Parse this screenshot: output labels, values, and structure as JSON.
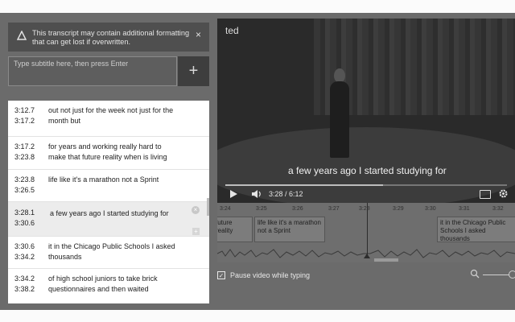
{
  "warning": {
    "text": "This transcript may contain additional formatting that can get lost if overwritten.",
    "dismiss_icon": "close-icon",
    "icon": "warning-triangle-icon"
  },
  "subtitle_input": {
    "placeholder": "Type subtitle here, then press Enter",
    "add_icon": "plus-icon"
  },
  "captions": [
    {
      "start": "3:12.7",
      "end": "3:17.2",
      "text": "out not just for the week not just for the month but"
    },
    {
      "start": "3:17.2",
      "end": "3:23.8",
      "text": "for years and working really hard to make that future reality when is living"
    },
    {
      "start": "3:23.8",
      "end": "3:26.5",
      "text": "life like it's a marathon not a Sprint"
    },
    {
      "start": "3:28.1",
      "end": "3:30.6",
      "text": "a few years ago I started studying for"
    },
    {
      "start": "3:30.6",
      "end": "3:34.2",
      "text": "it in the Chicago Public Schools I asked thousands"
    },
    {
      "start": "3:34.2",
      "end": "3:38.2",
      "text": "of high school juniors to take brick questionnaires and then waited"
    }
  ],
  "video": {
    "channel": "ted",
    "caption": "a few years ago I started studying for",
    "time": "3:28 / 6:12",
    "progress": 0.56
  },
  "timeline": {
    "ticks": [
      "3:24",
      "3:25",
      "3:26",
      "3:27",
      "3:28",
      "3:29",
      "3:30",
      "3:31",
      "3:32"
    ],
    "cues": [
      "future reality",
      "life like it's a marathon not a Sprint",
      "it in the Chicago Public Schools I asked thousands"
    ]
  },
  "pause_option": {
    "label": "Pause video while typing",
    "checked": true
  },
  "colors": {
    "overlay": "#5d5d5d",
    "panel": "#ffffff"
  }
}
